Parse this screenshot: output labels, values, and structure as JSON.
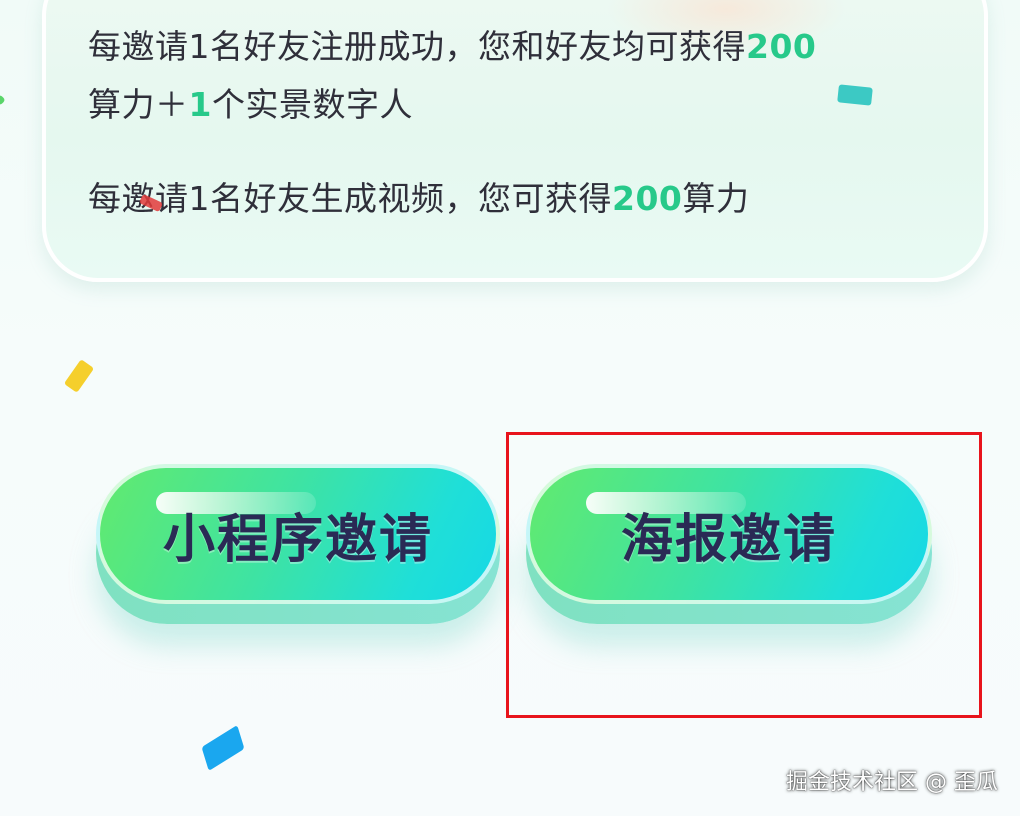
{
  "rules": {
    "line1_prefix": "每邀请1名好友注册成功，您和好友均可获得",
    "line1_highlight": "200",
    "line2_prefix": "算力＋",
    "line2_highlight": "1",
    "line2_suffix": "个实景数字人",
    "line3_prefix": "每邀请1名好友生成视频，您可获得",
    "line3_highlight": "200",
    "line3_suffix": "算力"
  },
  "buttons": {
    "mini_program_label": "小程序邀请",
    "poster_label": "海报邀请"
  },
  "watermark": {
    "text": "掘金技术社区 @ 歪瓜"
  },
  "colors": {
    "highlight_green": "#27c98a",
    "button_gradient_start": "#62ea6e",
    "button_gradient_end": "#16d8e6",
    "button_text": "#2a2a55",
    "annotation_red": "#e8141c"
  }
}
